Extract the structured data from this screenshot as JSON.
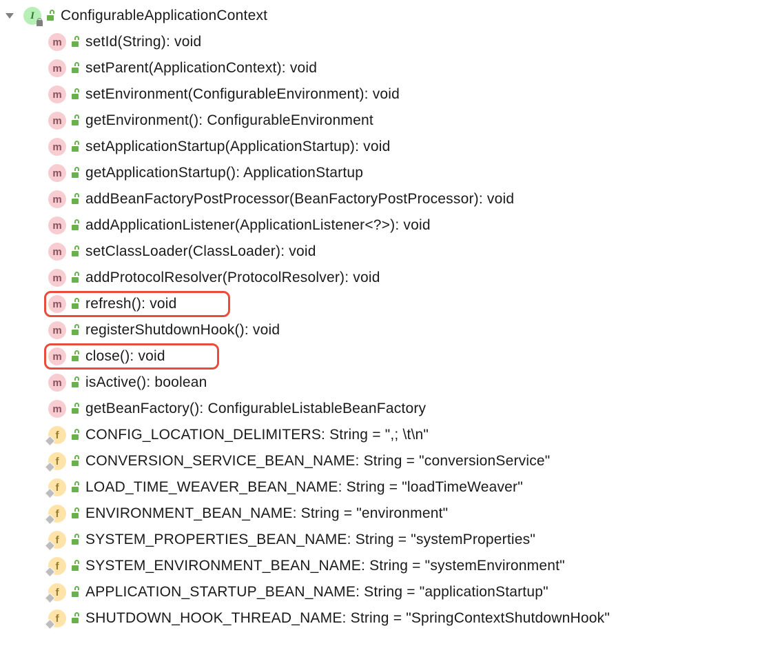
{
  "root": {
    "label": "ConfigurableApplicationContext",
    "kind": "interface"
  },
  "items": [
    {
      "kind": "method",
      "label": "setId(String): void"
    },
    {
      "kind": "method",
      "label": "setParent(ApplicationContext): void"
    },
    {
      "kind": "method",
      "label": "setEnvironment(ConfigurableEnvironment): void"
    },
    {
      "kind": "method",
      "label": "getEnvironment(): ConfigurableEnvironment"
    },
    {
      "kind": "method",
      "label": "setApplicationStartup(ApplicationStartup): void"
    },
    {
      "kind": "method",
      "label": "getApplicationStartup(): ApplicationStartup"
    },
    {
      "kind": "method",
      "label": "addBeanFactoryPostProcessor(BeanFactoryPostProcessor): void"
    },
    {
      "kind": "method",
      "label": "addApplicationListener(ApplicationListener<?>): void"
    },
    {
      "kind": "method",
      "label": "setClassLoader(ClassLoader): void"
    },
    {
      "kind": "method",
      "label": "addProtocolResolver(ProtocolResolver): void"
    },
    {
      "kind": "method",
      "label": "refresh(): void",
      "highlight": "refresh"
    },
    {
      "kind": "method",
      "label": "registerShutdownHook(): void"
    },
    {
      "kind": "method",
      "label": "close(): void",
      "highlight": "close"
    },
    {
      "kind": "method",
      "label": "isActive(): boolean"
    },
    {
      "kind": "method",
      "label": "getBeanFactory(): ConfigurableListableBeanFactory"
    },
    {
      "kind": "field",
      "label": "CONFIG_LOCATION_DELIMITERS: String = \",; \\t\\n\""
    },
    {
      "kind": "field",
      "label": "CONVERSION_SERVICE_BEAN_NAME: String = \"conversionService\""
    },
    {
      "kind": "field",
      "label": "LOAD_TIME_WEAVER_BEAN_NAME: String = \"loadTimeWeaver\""
    },
    {
      "kind": "field",
      "label": "ENVIRONMENT_BEAN_NAME: String = \"environment\""
    },
    {
      "kind": "field",
      "label": "SYSTEM_PROPERTIES_BEAN_NAME: String = \"systemProperties\""
    },
    {
      "kind": "field",
      "label": "SYSTEM_ENVIRONMENT_BEAN_NAME: String = \"systemEnvironment\""
    },
    {
      "kind": "field",
      "label": "APPLICATION_STARTUP_BEAN_NAME: String = \"applicationStartup\""
    },
    {
      "kind": "field",
      "label": "SHUTDOWN_HOOK_THREAD_NAME: String = \"SpringContextShutdownHook\""
    }
  ],
  "kindLetter": {
    "interface": "I",
    "method": "m",
    "field": "f"
  }
}
